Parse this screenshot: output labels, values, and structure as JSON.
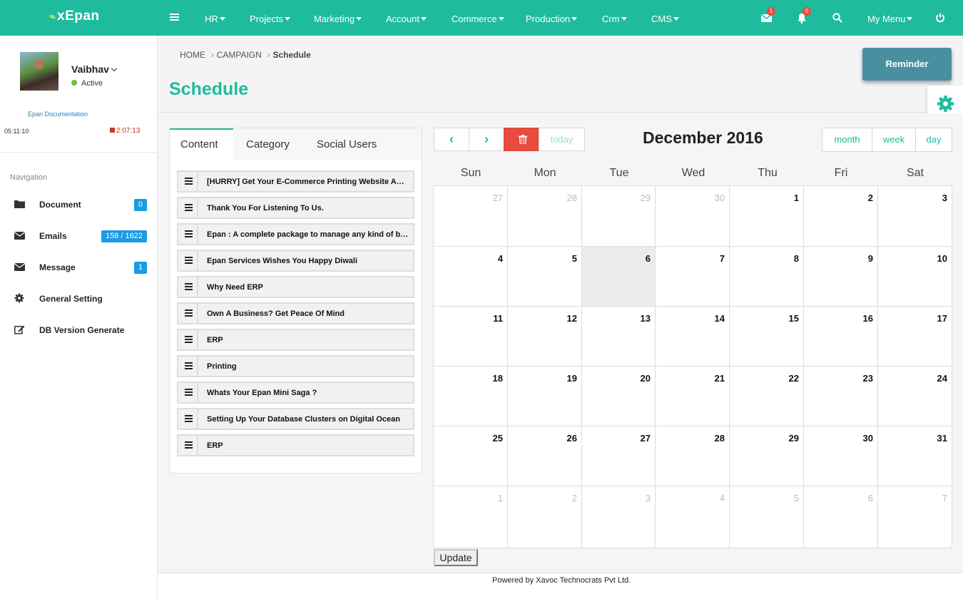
{
  "brand": "xEpan",
  "topnav": {
    "items": [
      "HR",
      "Projects",
      "Marketing",
      "Account",
      "Commerce",
      "Production",
      "Crm",
      "CMS"
    ],
    "mail_count": "1",
    "notif_count": "0",
    "my_menu": "My Menu"
  },
  "user": {
    "name": "Vaibhav",
    "status": "Active",
    "doc_link": "Epan Documentation",
    "time_elapsed": "05:11:10",
    "timer": "2:07:13"
  },
  "sidebar": {
    "title": "Navigation",
    "items": [
      {
        "label": "Document",
        "count": "0"
      },
      {
        "label": "Emails",
        "count": "158 / 1622"
      },
      {
        "label": "Message",
        "count": "1"
      },
      {
        "label": "General Setting",
        "count": ""
      },
      {
        "label": "DB Version Generate",
        "count": ""
      }
    ]
  },
  "breadcrumb": {
    "home": "HOME",
    "campaign": "CAMPAIGN",
    "current": "Schedule"
  },
  "page_title": "Schedule",
  "reminder_label": "Reminder",
  "tabs": [
    "Content",
    "Category",
    "Social Users"
  ],
  "content_items": [
    "[HURRY] Get Your E-Commerce Printing Website And Ready Printing Solution",
    "Thank You For Listening To Us.",
    "Epan : A complete package to manage any kind of business",
    "Epan Services Wishes You Happy Diwali",
    "Why Need ERP",
    "Own A Business? Get Peace Of Mind",
    "ERP",
    "Printing",
    "Whats Your Epan Mini Saga ?",
    "Setting Up Your Database Clusters on Digital Ocean",
    "ERP"
  ],
  "calendar": {
    "title": "December 2016",
    "today_label": "today",
    "views": [
      "month",
      "week",
      "day"
    ],
    "day_headers": [
      "Sun",
      "Mon",
      "Tue",
      "Wed",
      "Thu",
      "Fri",
      "Sat"
    ],
    "weeks": [
      [
        "27",
        "28",
        "29",
        "30",
        "1",
        "2",
        "3"
      ],
      [
        "4",
        "5",
        "6",
        "7",
        "8",
        "9",
        "10"
      ],
      [
        "11",
        "12",
        "13",
        "14",
        "15",
        "16",
        "17"
      ],
      [
        "18",
        "19",
        "20",
        "21",
        "22",
        "23",
        "24"
      ],
      [
        "25",
        "26",
        "27",
        "28",
        "29",
        "30",
        "31"
      ],
      [
        "1",
        "2",
        "3",
        "4",
        "5",
        "6",
        "7"
      ]
    ],
    "highlighted_day": "6"
  },
  "update_label": "Update",
  "footer": "Powered by Xavoc Technocrats Pvt Ltd.",
  "colors": {
    "accent": "#1ebc9c",
    "danger": "#e74c3c",
    "badge": "#1a9be6",
    "reminder": "#4a8fa0"
  }
}
